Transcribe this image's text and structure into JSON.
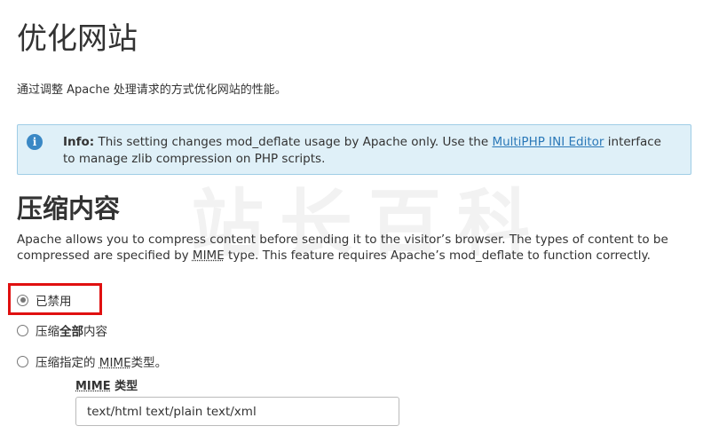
{
  "page": {
    "title": "优化网站",
    "description": "通过调整 Apache 处理请求的方式优化网站的性能。"
  },
  "info": {
    "icon": "info-icon",
    "label": "Info:",
    "text_before": " This setting changes mod_deflate usage by Apache only. Use the ",
    "link_text": "MultiPHP INI Editor",
    "text_after": " interface to manage zlib compression on PHP scripts."
  },
  "section": {
    "title": "压缩内容",
    "desc_part1": "Apache allows you to compress content before sending it to the visitor’s browser. The types of content to be compressed are specified by ",
    "desc_abbr": "MIME",
    "desc_part2": " type. This feature requires Apache’s mod_deflate to function correctly."
  },
  "options": [
    {
      "label": "已禁用",
      "checked": true
    },
    {
      "label_before": "压缩",
      "label_bold": "全部",
      "label_after": "内容",
      "checked": false
    },
    {
      "label_before": "压缩指定的 ",
      "label_abbr": "MIME",
      "label_after": "类型。",
      "checked": false
    }
  ],
  "mime": {
    "label_abbr": "MIME",
    "label_rest": " 类型",
    "value": "text/html text/plain text/xml"
  },
  "watermark": {
    "text": "站长百科"
  },
  "colors": {
    "info_bg": "#dff0f8",
    "info_border": "#9fcde6",
    "info_icon": "#3a88c5",
    "link": "#2a78b8",
    "highlight": "#e01010"
  }
}
